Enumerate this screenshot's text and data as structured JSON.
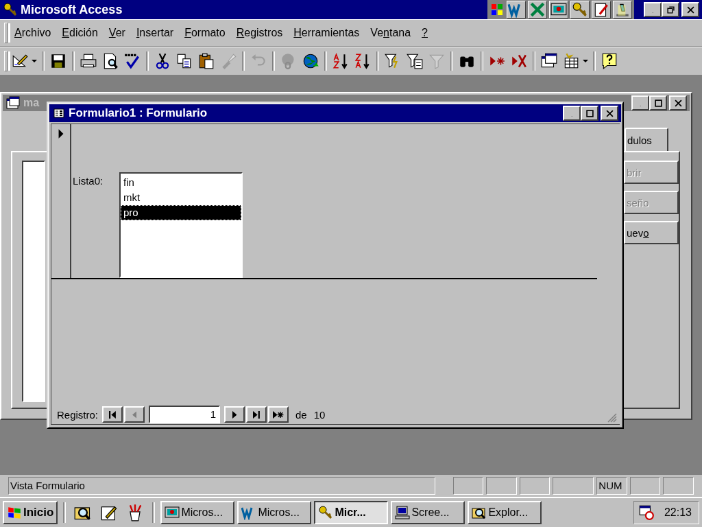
{
  "window": {
    "title": "Microsoft Access"
  },
  "menu": [
    {
      "key": "A",
      "after": "rchivo"
    },
    {
      "key": "E",
      "after": "dición"
    },
    {
      "key": "V",
      "after": "er"
    },
    {
      "key": "I",
      "after": "nsertar"
    },
    {
      "key": "F",
      "after": "ormato"
    },
    {
      "key": "R",
      "after": "egistros"
    },
    {
      "key": "H",
      "after": "erramientas"
    },
    {
      "before": "Ve",
      "key": "n",
      "after": "tana"
    },
    {
      "key": "?"
    }
  ],
  "toolbar": [
    {
      "kind": "design",
      "disabled": false
    },
    {
      "kind": "separator"
    },
    {
      "kind": "save",
      "disabled": false
    },
    {
      "kind": "separator"
    },
    {
      "kind": "print",
      "disabled": false
    },
    {
      "kind": "preview",
      "disabled": false
    },
    {
      "kind": "spelling",
      "disabled": false
    },
    {
      "kind": "separator"
    },
    {
      "kind": "cut",
      "disabled": false
    },
    {
      "kind": "copy",
      "disabled": false
    },
    {
      "kind": "paste",
      "disabled": false
    },
    {
      "kind": "painter",
      "disabled": true
    },
    {
      "kind": "separator"
    },
    {
      "kind": "undo",
      "disabled": true
    },
    {
      "kind": "separator"
    },
    {
      "kind": "hyperlink",
      "disabled": true
    },
    {
      "kind": "web",
      "disabled": false
    },
    {
      "kind": "separator"
    },
    {
      "kind": "sortasc",
      "disabled": false
    },
    {
      "kind": "sortdesc",
      "disabled": false
    },
    {
      "kind": "separator"
    },
    {
      "kind": "filtersel",
      "disabled": false
    },
    {
      "kind": "filterform",
      "disabled": false
    },
    {
      "kind": "filter",
      "disabled": true
    },
    {
      "kind": "separator"
    },
    {
      "kind": "find",
      "disabled": false
    },
    {
      "kind": "separator"
    },
    {
      "kind": "newrec",
      "disabled": false
    },
    {
      "kind": "delrec",
      "disabled": false
    },
    {
      "kind": "separator"
    },
    {
      "kind": "dbwin",
      "disabled": false
    },
    {
      "kind": "newobj",
      "disabled": false
    },
    {
      "kind": "separator"
    },
    {
      "kind": "help",
      "disabled": false
    }
  ],
  "database_window": {
    "title": "ma",
    "tab": "dulos",
    "buttons": [
      {
        "before": "brir",
        "disabled": true
      },
      {
        "before": "seño",
        "disabled": true
      },
      {
        "before": "uev",
        "key": "o",
        "disabled": false
      }
    ]
  },
  "form_window": {
    "title": "Formulario1 : Formulario",
    "list_label": "Lista0:",
    "list_items": [
      {
        "text": "fin",
        "selected": false
      },
      {
        "text": "mkt",
        "selected": false
      },
      {
        "text": "pro",
        "selected": true
      }
    ],
    "navigation": {
      "label": "Registro:",
      "record": "1",
      "of": "de",
      "total": "10",
      "buttons": [
        {
          "kind": "first",
          "disabled": false
        },
        {
          "kind": "prev",
          "disabled": true
        }
      ],
      "buttons_after": [
        {
          "kind": "next",
          "disabled": false
        },
        {
          "kind": "last",
          "disabled": false
        },
        {
          "kind": "new",
          "disabled": false
        }
      ]
    }
  },
  "status_bar": {
    "text": "Vista Formulario",
    "panes": [
      {
        "kind": "empty"
      },
      {
        "kind": "empty"
      },
      {
        "kind": "empty"
      },
      {
        "kind": "empty"
      },
      {
        "kind": "text",
        "label": "NUM"
      },
      {
        "kind": "empty"
      },
      {
        "kind": "empty"
      }
    ]
  },
  "taskbar": {
    "start": "Inicio",
    "tasks": [
      {
        "kind": "slides",
        "label": "Micros...",
        "selected": false
      },
      {
        "kind": "word",
        "label": "Micros...",
        "selected": false
      },
      {
        "kind": "key",
        "label": "Micr...",
        "selected": true
      },
      {
        "kind": "computer",
        "label": "Scree...",
        "selected": false
      },
      {
        "kind": "explorer",
        "label": "Explor...",
        "selected": false
      }
    ],
    "clock": "22:13"
  }
}
